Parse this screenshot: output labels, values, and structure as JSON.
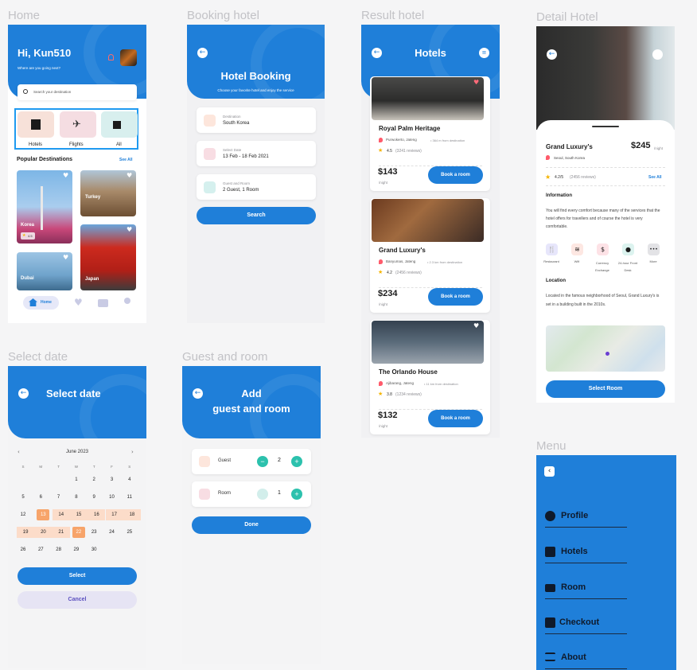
{
  "labels": {
    "home": "Home",
    "booking": "Booking hotel",
    "result": "Result hotel",
    "detail": "Detail Hotel",
    "select_date": "Select date",
    "guest_room": "Guest and room",
    "menu": "Menu"
  },
  "home": {
    "greeting": "Hi, Kun510",
    "subtitle": "Where are you going next?",
    "search_placeholder": "Search your destination",
    "categories": [
      {
        "label": "Hotels",
        "icon": "hotel-icon"
      },
      {
        "label": "Flights",
        "icon": "plane-icon"
      },
      {
        "label": "All",
        "icon": "hotel-plane-icon"
      }
    ],
    "popular_title": "Popular Destinations",
    "see_all": "See All",
    "destinations": [
      {
        "name": "Korea",
        "rating": "4.5"
      },
      {
        "name": "Turkey",
        "rating": ""
      },
      {
        "name": "Dubai",
        "rating": ""
      },
      {
        "name": "Japan",
        "rating": ""
      }
    ],
    "nav": {
      "home_label": "Home"
    }
  },
  "booking": {
    "title": "Hotel Booking",
    "subtitle": "Choose your favorite hotel and enjoy the service",
    "fields": [
      {
        "label": "Destination",
        "value": "South Korea",
        "icon": "location-icon"
      },
      {
        "label": "Select Date",
        "value": "13 Feb - 18 Feb 2021",
        "icon": "calendar-icon"
      },
      {
        "label": "Guest and Room",
        "value": "2 Guest, 1 Room",
        "icon": "bed-icon"
      }
    ],
    "search_button": "Search"
  },
  "result": {
    "title": "Hotels",
    "hotels": [
      {
        "name": "Royal Palm Heritage",
        "location": "Purwokerto, Jateng",
        "distance": "• 364 m from destination",
        "rating": "4.5",
        "reviews": "(3241 reviews)",
        "price": "$143",
        "per": "/night",
        "button": "Book a room"
      },
      {
        "name": "Grand Luxury's",
        "location": "Banyumas, Jateng",
        "distance": "• 2.3 km from destination",
        "rating": "4.2",
        "reviews": "(2456 reviews)",
        "price": "$234",
        "per": "/night",
        "button": "Book a room"
      },
      {
        "name": "The Orlando House",
        "location": "Ajibarang, Jateng",
        "distance": "• 11 km from destination",
        "rating": "3.8",
        "reviews": "(1234 reviews)",
        "price": "$132",
        "per": "/night",
        "button": "Book a room"
      }
    ]
  },
  "detail": {
    "name": "Grand Luxury's",
    "price": "$245",
    "per": "/night",
    "location": "Seoul, South Korea",
    "rating": "4.2/5",
    "reviews": "(2456 reviews)",
    "see_all": "See All",
    "info_title": "Information",
    "info_text": "You will find every comfort because many of the services that the hotel offers for travellers and of course the hotel is very comfortable.",
    "facilities": [
      {
        "label": "Restaurant",
        "icon": "fork-knife-icon",
        "glyph": "🍴",
        "bg": "#e7e6fb",
        "fg": "#1f2a44"
      },
      {
        "label": "Wifi",
        "icon": "wifi-icon",
        "glyph": "≋",
        "bg": "#fde7e2",
        "fg": "#1f2a44"
      },
      {
        "label": "Currency Exchange",
        "icon": "dollar-icon",
        "glyph": "$",
        "bg": "#fde2e6",
        "fg": "#1f2a44"
      },
      {
        "label": "24-hour Front Desk",
        "icon": "person-icon",
        "glyph": "●",
        "bg": "#dcf3ef",
        "fg": "#1f2a44"
      },
      {
        "label": "More",
        "icon": "more-icon",
        "glyph": "•••",
        "bg": "#e3e3e6",
        "fg": "#1f2a44"
      }
    ],
    "location_title": "Location",
    "location_text": "Located in the famous neighborhood of Seoul, Grand Luxury's is set in a building built in the 2010s.",
    "button": "Select Room"
  },
  "calendar": {
    "title": "Select date",
    "month": "June 2023",
    "weekdays": [
      "S",
      "M",
      "T",
      "W",
      "T",
      "F",
      "S"
    ],
    "rows": [
      [
        "",
        "",
        "",
        "1",
        "2",
        "3",
        "4"
      ],
      [
        "5",
        "6",
        "7",
        "8",
        "9",
        "10",
        "11"
      ],
      [
        "12",
        "13",
        "14",
        "15",
        "16",
        "17",
        "18"
      ],
      [
        "19",
        "20",
        "21",
        "22",
        "23",
        "24",
        "25"
      ],
      [
        "26",
        "27",
        "28",
        "29",
        "30",
        "",
        ""
      ]
    ],
    "select_button": "Select",
    "cancel_button": "Cancel"
  },
  "guest": {
    "title_line1": "Add",
    "title_line2": "guest and room",
    "guest_label": "Guest",
    "guest_count": "2",
    "room_label": "Room",
    "room_count": "1",
    "done_button": "Done"
  },
  "menu": {
    "items": [
      {
        "label": "Profile",
        "icon": "profile-icon"
      },
      {
        "label": "Hotels",
        "icon": "hotel-icon"
      },
      {
        "label": "Room",
        "icon": "bed-icon"
      },
      {
        "label": "Checkout",
        "icon": "checkbox-icon"
      },
      {
        "label": "About",
        "icon": "menu-lines-icon"
      }
    ]
  }
}
